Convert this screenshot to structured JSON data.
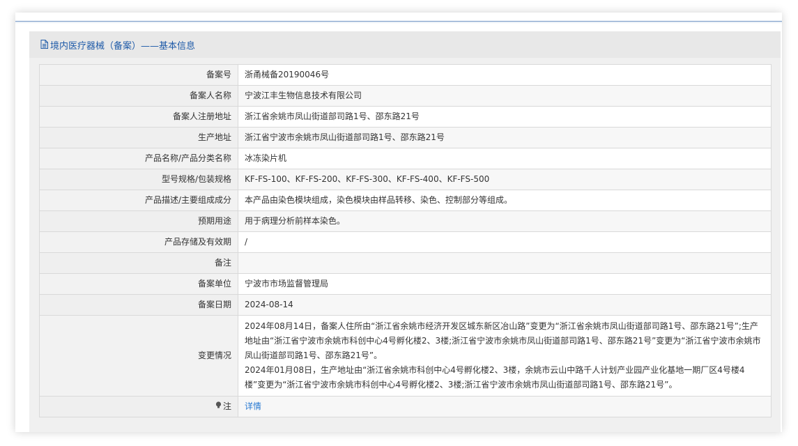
{
  "header": {
    "title": "境内医疗器械（备案）——基本信息",
    "icon": "document-icon",
    "color": "#1e5aa8"
  },
  "rows": [
    {
      "label": "备案号",
      "value": "浙甬械备20190046号"
    },
    {
      "label": "备案人名称",
      "value": "宁波江丰生物信息技术有限公司"
    },
    {
      "label": "备案人注册地址",
      "value": "浙江省余姚市凤山街道部司路1号、邵东路21号"
    },
    {
      "label": "生产地址",
      "value": "浙江省宁波市余姚市凤山街道部司路1号、邵东路21号"
    },
    {
      "label": "产品名称/产品分类名称",
      "value": "冰冻染片机"
    },
    {
      "label": "型号规格/包装规格",
      "value": "KF-FS-100、KF-FS-200、KF-FS-300、KF-FS-400、KF-FS-500"
    },
    {
      "label": "产品描述/主要组成成分",
      "value": "本产品由染色模块组成，染色模块由样品转移、染色、控制部分等组成。"
    },
    {
      "label": "预期用途",
      "value": "用于病理分析前样本染色。"
    },
    {
      "label": "产品存储及有效期",
      "value": "/"
    },
    {
      "label": "备注",
      "value": ""
    },
    {
      "label": "备案单位",
      "value": "宁波市市场监督管理局"
    },
    {
      "label": "备案日期",
      "value": "2024-08-14"
    }
  ],
  "change": {
    "label": "变更情况",
    "paragraphs": [
      "2024年08月14日，备案人住所由“浙江省余姚市经济开发区城东新区冶山路”变更为“浙江省余姚市凤山街道部司路1号、邵东路21号”;生产地址由“浙江省宁波市余姚市科创中心4号孵化楼2、3楼;浙江省宁波市余姚市凤山街道部司路1号、邵东路21号”变更为“浙江省宁波市余姚市凤山街道部司路1号、邵东路21号”。",
      "2024年01月08日，生产地址由“浙江省余姚市科创中心4号孵化楼2、3楼，余姚市云山中路千人计划产业园产业化基地一期厂区4号楼4楼”变更为“浙江省宁波市余姚市科创中心4号孵化楼2、3楼;浙江省宁波市余姚市凤山街道部司路1号、邵东路21号”。"
    ]
  },
  "note": {
    "label": "注",
    "icon": "bulb-icon",
    "link_text": "详情",
    "link_color": "#2a7ad2"
  }
}
